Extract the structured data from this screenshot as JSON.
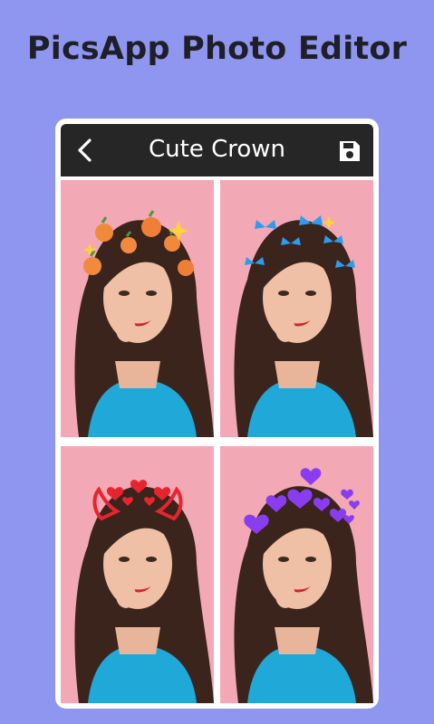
{
  "promo": {
    "title": "PicsApp Photo Editor"
  },
  "app_bar": {
    "title": "Cute Crown",
    "back_icon": "chevron-left-icon",
    "save_icon": "save-icon"
  },
  "colors": {
    "background": "#8f96f0",
    "app_bar": "#262626",
    "photo_background": "#f2a9b5"
  },
  "stickers": [
    {
      "name": "peach-crown",
      "accent": "#f08a3a"
    },
    {
      "name": "butterfly-crown",
      "accent": "#2a9df0"
    },
    {
      "name": "devil-horns-crown",
      "accent": "#e8242f"
    },
    {
      "name": "purple-hearts-crown",
      "accent": "#8a3df0"
    }
  ]
}
